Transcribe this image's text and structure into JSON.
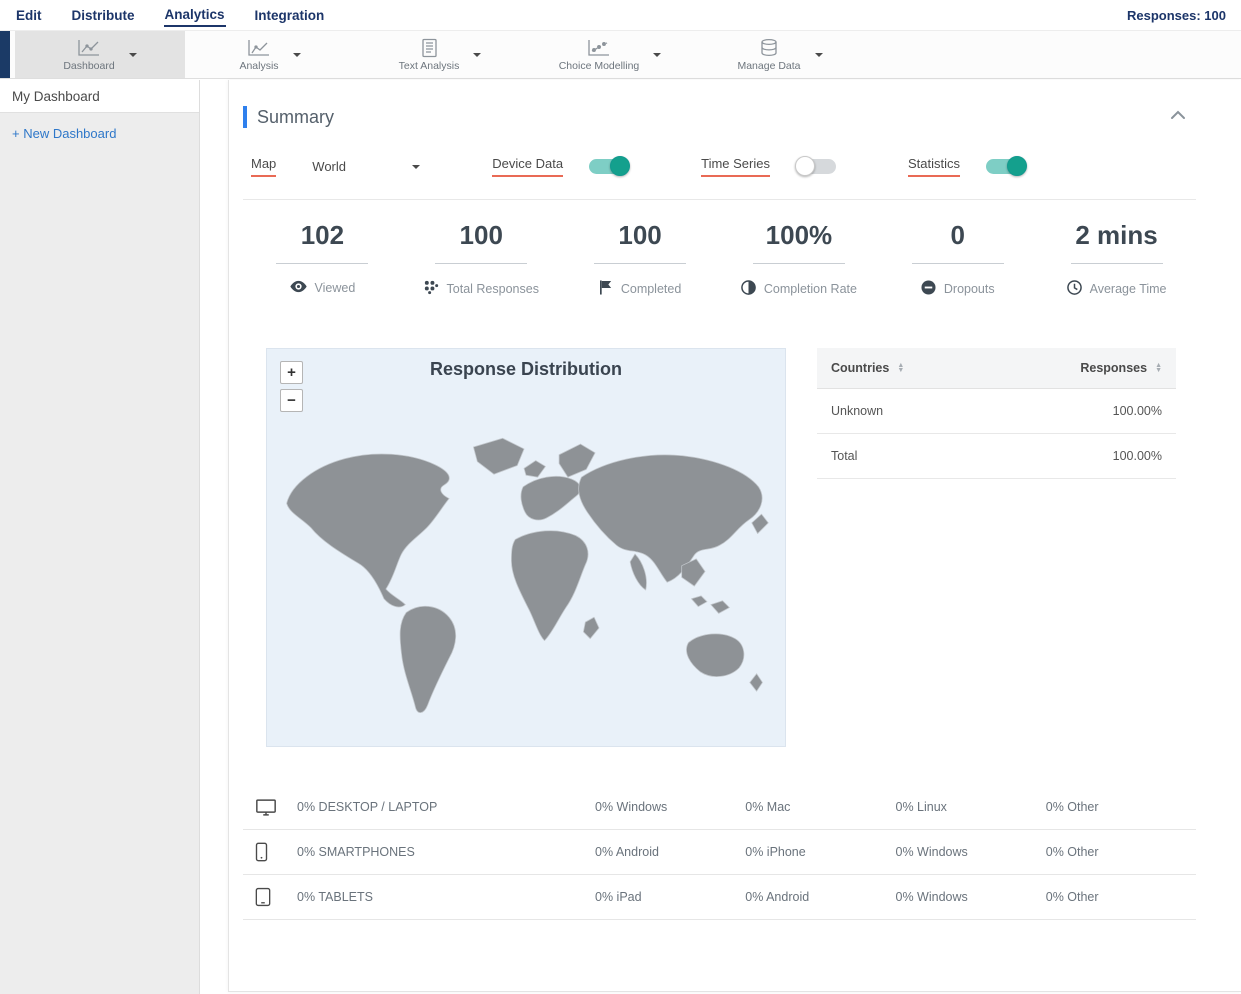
{
  "topnav": {
    "items": [
      {
        "label": "Edit"
      },
      {
        "label": "Distribute"
      },
      {
        "label": "Analytics"
      },
      {
        "label": "Integration"
      }
    ],
    "responses": "Responses: 100"
  },
  "toolbar": {
    "items": [
      {
        "label": "Dashboard"
      },
      {
        "label": "Analysis"
      },
      {
        "label": "Text Analysis"
      },
      {
        "label": "Choice Modelling"
      },
      {
        "label": "Manage Data"
      }
    ]
  },
  "sidebar": {
    "active_item": "My Dashboard",
    "plus": "+",
    "new_dashboard": "New Dashboard"
  },
  "summary": {
    "title": "Summary",
    "controls": {
      "map_label": "Map",
      "map_value": "World",
      "device_data_label": "Device Data",
      "device_data_on": true,
      "time_series_label": "Time Series",
      "time_series_on": false,
      "statistics_label": "Statistics",
      "statistics_on": true
    },
    "stats": [
      {
        "value": "102",
        "label": "Viewed"
      },
      {
        "value": "100",
        "label": "Total Responses"
      },
      {
        "value": "100",
        "label": "Completed"
      },
      {
        "value": "100%",
        "label": "Completion Rate"
      },
      {
        "value": "0",
        "label": "Dropouts"
      },
      {
        "value": "2 mins",
        "label": "Average Time"
      }
    ],
    "map": {
      "title": "Response Distribution",
      "zoom_in": "+",
      "zoom_out": "−"
    },
    "countries_table": {
      "col_country": "Countries",
      "col_responses": "Responses",
      "rows": [
        {
          "country": "Unknown",
          "responses": "100.00%"
        },
        {
          "country": "Total",
          "responses": "100.00%"
        }
      ]
    },
    "devices": [
      {
        "label": "0% DESKTOP / LAPTOP",
        "cols": [
          "0% Windows",
          "0% Mac",
          "0% Linux",
          "0% Other"
        ]
      },
      {
        "label": "0% SMARTPHONES",
        "cols": [
          "0% Android",
          "0% iPhone",
          "0% Windows",
          "0% Other"
        ]
      },
      {
        "label": "0% TABLETS",
        "cols": [
          "0% iPad",
          "0% Android",
          "0% Windows",
          "0% Other"
        ]
      }
    ]
  },
  "colors": {
    "nav_blue": "#1c3569",
    "accent_blue": "#2f80ed",
    "underline_red": "#e96a55",
    "toggle_on": "#14a08d",
    "map_background": "#e9f1f9",
    "map_land": "#8e9296"
  }
}
